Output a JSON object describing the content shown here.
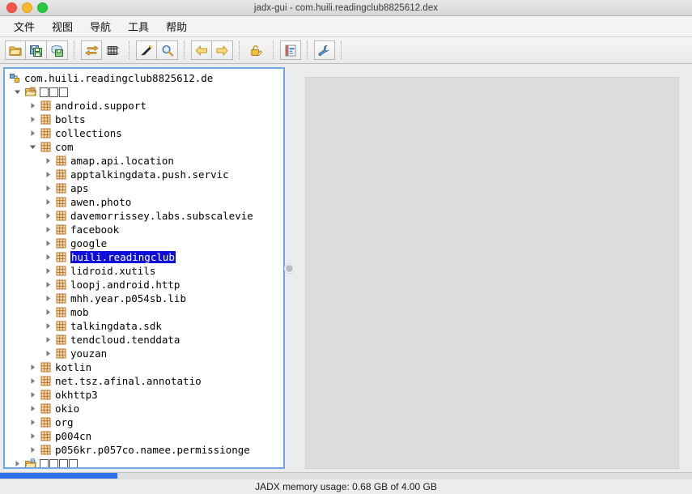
{
  "window": {
    "title": "jadx-gui - com.huili.readingclub8825612.dex",
    "traffic_lights": [
      "close-button",
      "minimize-button",
      "zoom-button"
    ]
  },
  "menubar": {
    "items": [
      {
        "label": "文件",
        "name": "menu-file"
      },
      {
        "label": "视图",
        "name": "menu-view"
      },
      {
        "label": "导航",
        "name": "menu-navigation"
      },
      {
        "label": "工具",
        "name": "menu-tools"
      },
      {
        "label": "帮助",
        "name": "menu-help"
      }
    ]
  },
  "toolbar": {
    "groups": [
      [
        "open-file-icon",
        "save-all-icon",
        "export-gradle-icon"
      ],
      [
        "sync-icon",
        "flatten-packages-icon"
      ],
      [
        "search-class-icon",
        "search-text-icon"
      ],
      [
        "back-arrow-icon",
        "forward-arrow-icon"
      ],
      [
        "deobfuscation-icon"
      ],
      [
        "log-viewer-icon"
      ],
      [
        "preferences-icon"
      ]
    ]
  },
  "tree": {
    "root": {
      "label": "com.huili.readingclub8825612.de",
      "icon": "dex-file-icon",
      "expanded": true
    },
    "nodes": [
      {
        "level": 0,
        "label": "源代码",
        "cjk_boxes": 3,
        "icon": "open-package-folder-icon",
        "twisty": "expanded",
        "selected": false
      },
      {
        "level": 1,
        "label": "android.support",
        "icon": "package-icon",
        "twisty": "collapsed",
        "selected": false
      },
      {
        "level": 1,
        "label": "bolts",
        "icon": "package-icon",
        "twisty": "collapsed",
        "selected": false
      },
      {
        "level": 1,
        "label": "collections",
        "icon": "package-icon",
        "twisty": "collapsed",
        "selected": false
      },
      {
        "level": 1,
        "label": "com",
        "icon": "package-icon",
        "twisty": "expanded",
        "selected": false
      },
      {
        "level": 2,
        "label": "amap.api.location",
        "icon": "package-icon",
        "twisty": "collapsed",
        "selected": false
      },
      {
        "level": 2,
        "label": "apptalkingdata.push.servic",
        "icon": "package-icon",
        "twisty": "collapsed",
        "selected": false
      },
      {
        "level": 2,
        "label": "aps",
        "icon": "package-icon",
        "twisty": "collapsed",
        "selected": false
      },
      {
        "level": 2,
        "label": "awen.photo",
        "icon": "package-icon",
        "twisty": "collapsed",
        "selected": false
      },
      {
        "level": 2,
        "label": "davemorrissey.labs.subscalevie",
        "icon": "package-icon",
        "twisty": "collapsed",
        "selected": false
      },
      {
        "level": 2,
        "label": "facebook",
        "icon": "package-icon",
        "twisty": "collapsed",
        "selected": false
      },
      {
        "level": 2,
        "label": "google",
        "icon": "package-icon",
        "twisty": "collapsed",
        "selected": false
      },
      {
        "level": 2,
        "label": "huili.readingclub",
        "icon": "package-icon",
        "twisty": "collapsed",
        "selected": true
      },
      {
        "level": 2,
        "label": "lidroid.xutils",
        "icon": "package-icon",
        "twisty": "collapsed",
        "selected": false
      },
      {
        "level": 2,
        "label": "loopj.android.http",
        "icon": "package-icon",
        "twisty": "collapsed",
        "selected": false
      },
      {
        "level": 2,
        "label": "mhh.year.p054sb.lib",
        "icon": "package-icon",
        "twisty": "collapsed",
        "selected": false
      },
      {
        "level": 2,
        "label": "mob",
        "icon": "package-icon",
        "twisty": "collapsed",
        "selected": false
      },
      {
        "level": 2,
        "label": "talkingdata.sdk",
        "icon": "package-icon",
        "twisty": "collapsed",
        "selected": false
      },
      {
        "level": 2,
        "label": "tendcloud.tenddata",
        "icon": "package-icon",
        "twisty": "collapsed",
        "selected": false
      },
      {
        "level": 2,
        "label": "youzan",
        "icon": "package-icon",
        "twisty": "collapsed",
        "selected": false
      },
      {
        "level": 1,
        "label": "kotlin",
        "icon": "package-icon",
        "twisty": "collapsed",
        "selected": false
      },
      {
        "level": 1,
        "label": "net.tsz.afinal.annotatio",
        "icon": "package-icon",
        "twisty": "collapsed",
        "selected": false
      },
      {
        "level": 1,
        "label": "okhttp3",
        "icon": "package-icon",
        "twisty": "collapsed",
        "selected": false
      },
      {
        "level": 1,
        "label": "okio",
        "icon": "package-icon",
        "twisty": "collapsed",
        "selected": false
      },
      {
        "level": 1,
        "label": "org",
        "icon": "package-icon",
        "twisty": "collapsed",
        "selected": false
      },
      {
        "level": 1,
        "label": "p004cn",
        "icon": "package-icon",
        "twisty": "collapsed",
        "selected": false
      },
      {
        "level": 1,
        "label": "p056kr.p057co.namee.permissionge",
        "icon": "package-icon",
        "twisty": "collapsed",
        "selected": false
      },
      {
        "level": 0,
        "label": "资源文件",
        "cjk_boxes": 4,
        "icon": "resources-folder-icon",
        "twisty": "collapsed",
        "selected": false
      }
    ]
  },
  "editor": {
    "empty": true
  },
  "status": {
    "memory_text": "JADX memory usage: 0.68 GB of 4.00 GB",
    "progress_percent": 17
  },
  "colors": {
    "selection": "#0f0fd8",
    "progress": "#2f6fe8",
    "panel_border": "#6ea8e0",
    "window_bg": "#ececec"
  }
}
